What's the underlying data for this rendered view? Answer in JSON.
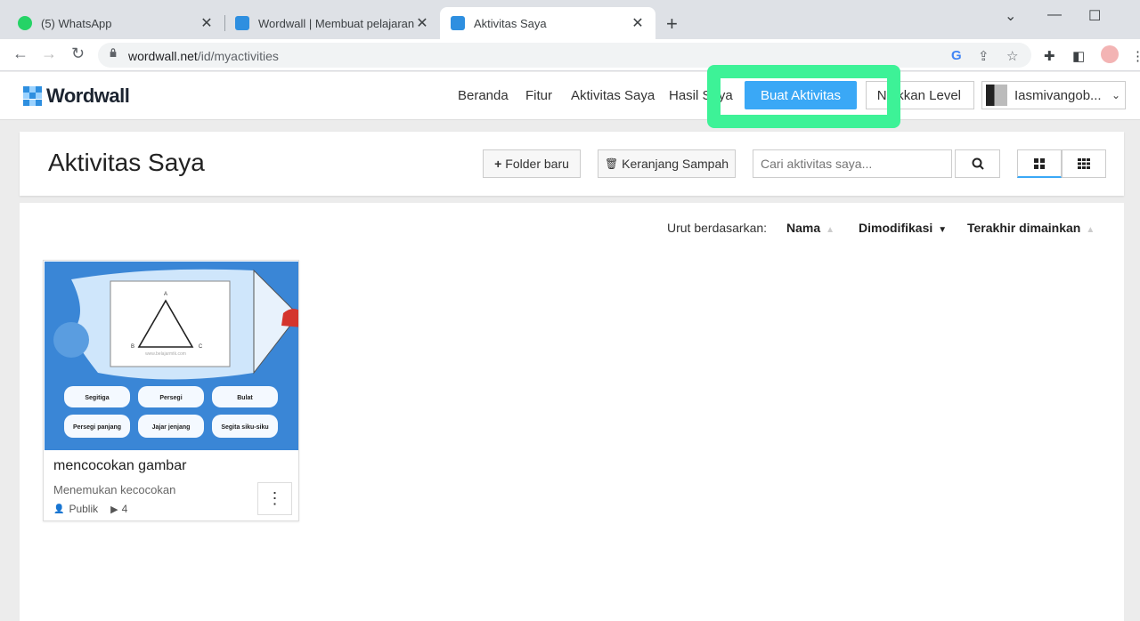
{
  "browser": {
    "tabs": [
      {
        "title": "(5) WhatsApp",
        "icon": "whatsapp-icon"
      },
      {
        "title": "Wordwall | Membuat pelajaran yang lebih baik",
        "icon": "wordwall-icon"
      },
      {
        "title": "Aktivitas Saya",
        "icon": "wordwall-icon"
      }
    ],
    "url_host": "wordwall.net",
    "url_path": "/id/myactivities"
  },
  "header": {
    "logo_text": "Wordwall",
    "nav": [
      "Beranda",
      "Fitur",
      "Aktivitas Saya",
      "Hasil Saya"
    ],
    "create_label": "Buat Aktivitas",
    "level_label": "Naikkan Level",
    "user_name": "Iasmivangob..."
  },
  "page": {
    "title": "Aktivitas Saya",
    "new_folder_label": "Folder baru",
    "trash_label": "Keranjang Sampah",
    "search_placeholder": "Cari aktivitas saya..."
  },
  "sort": {
    "label": "Urut berdasarkan:",
    "options": [
      "Nama",
      "Dimodifikasi",
      "Terakhir dimainkan"
    ]
  },
  "activity": {
    "title": "mencocokan gambar",
    "type": "Menemukan kecocokan",
    "visibility": "Publik",
    "plays": "4",
    "thumb": {
      "vertices": [
        "A",
        "B",
        "C"
      ],
      "watermark": "www.belajarmtk.com",
      "options": [
        "Segitiga",
        "Persegi",
        "Bulat",
        "Persegi panjang",
        "Jajar jenjang",
        "Segita siku-siku"
      ]
    }
  },
  "colors": {
    "accent": "#3aa8f6",
    "highlight": "#3df297",
    "thumb_bg": "#3a86d6"
  }
}
